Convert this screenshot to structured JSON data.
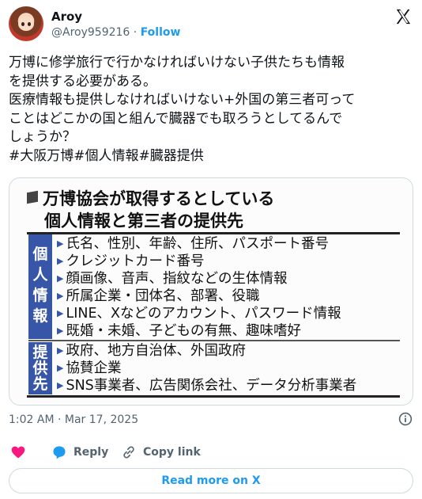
{
  "author": {
    "name": "Aroy",
    "handle": "@Aroy959216",
    "separator": "·",
    "follow_label": "Follow"
  },
  "tweet": {
    "lines": [
      "万博に修学旅行で行かなければいけない子供たちも情報",
      "を提供する必要がある。",
      "医療情報も提供しなければいけない+外国の第三者可って",
      "ことはどこかの国と組んで臓器でも取ろうとしてるんで",
      "しょうか？",
      "#大阪万博#個人情報#臓器提供"
    ]
  },
  "card": {
    "title_line1": "万博協会が取得するとしている",
    "title_line2": "個人情報と第三者の提供先",
    "section1_label": "個人情報",
    "section1_items": [
      "氏名、性別、年齢、住所、パスポート番号",
      "クレジットカード番号",
      "顔画像、音声、指紋などの生体情報",
      "所属企業・団体名、部署、役職",
      "LINE、Xなどのアカウント、パスワード情報",
      "既婚・未婚、子どもの有無、趣味嗜好"
    ],
    "section2_label": "提供先",
    "section2_items": [
      "政府、地方自治体、外国政府",
      "協賛企業",
      "SNS事業者、広告関係会社、データ分析事業者"
    ]
  },
  "meta": {
    "timestamp": "1:02 AM · Mar 17, 2025"
  },
  "actions": {
    "reply_label": "Reply",
    "copy_label": "Copy link"
  },
  "read_more_label": "Read more on X",
  "colors": {
    "accent": "#1d9bf0",
    "heart": "#f91880",
    "card_sidebar": "#3856a8"
  }
}
